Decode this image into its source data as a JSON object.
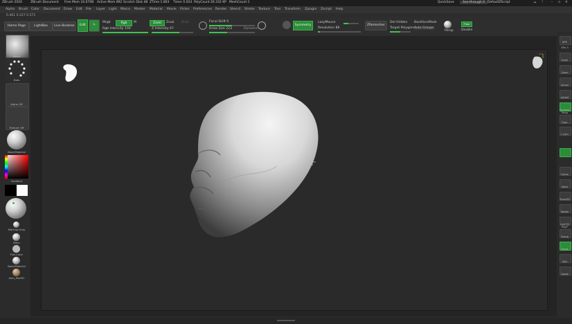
{
  "titlebar": {
    "items": [
      "ZBrush 2020",
      "ZBrush Document",
      "Free Mem 24.670B",
      "Active Mem 892",
      "Scratch Disk 48",
      "ZTime 1.803",
      "Timer 0.024",
      "PolyCount 26.332 KP",
      "MeshCount 1"
    ],
    "quicksave": "QuickSave",
    "seethrough": "See-through 0",
    "script": "DefaultZScript"
  },
  "menubar": [
    "Alpha",
    "Brush",
    "Color",
    "Document",
    "Draw",
    "Edit",
    "File",
    "Layer",
    "Light",
    "Macro",
    "Marker",
    "Material",
    "Movie",
    "Picker",
    "Preferences",
    "Render",
    "Stencil",
    "Stroke",
    "Texture",
    "Tool",
    "Transform",
    "Zplugin",
    "Zscript",
    "Help"
  ],
  "info_line": "0.461 0.227 0.571",
  "toolbar": {
    "home_page": "Home Page",
    "lightbox": "LightBox",
    "live_boolean": "Live Boolean",
    "edit": "Edit",
    "draw": "Draw",
    "mrgb": "Mrgb",
    "rgb": "Rgb",
    "m": "M",
    "zadd": "Zadd",
    "zsub": "Zsub",
    "zcut": "Zcut",
    "rgb_intensity": "Rgb Intensity 100",
    "z_intensity": "Z Intensity 67",
    "focal_shift": "Focal Shift 0",
    "draw_size": "Draw Size 223",
    "dynamic": "Dynamic",
    "symmetry": "Symmetry",
    "lazymouse": "LazyMouse",
    "resolution": "Resolution 88",
    "zremesher": "ZRemesher",
    "del_hidden": "Del Hidden",
    "backface_mask": "BackfaceMask",
    "target_polygons": "Target Polygons",
    "auto_groups": "Auto Groups",
    "persp": "Persp",
    "floor": "Floor",
    "double": "Double"
  },
  "left_shelf": {
    "brush_label": "Move",
    "stroke_label": "Dots",
    "alpha_label": "Alpha Off",
    "texture_label": "Texture Off",
    "material_label": "BasicMaterial",
    "gradient_label": "Gradient",
    "matcap_label": "MatCap Gray",
    "mat_list": [
      "Blinn",
      "Flat Color",
      "BasicMaterial",
      "zbro_Mod01"
    ]
  },
  "right_shelf": [
    "BPR",
    "SPix 3",
    "Scroll",
    "Zoom",
    "Actual",
    "AAHalf",
    "Dynamic Persp",
    "Floor",
    "L.Sym",
    "Frame",
    "Move",
    "Zoom3D",
    "Rotate",
    "Line Fill PolyF",
    "Transp",
    "Ghost",
    "Solo",
    "Xpose"
  ],
  "colors": {
    "accent_green": "#3fb04e",
    "canvas_bg": "#2a2a2a",
    "ui_bg": "#2b2b2b"
  }
}
